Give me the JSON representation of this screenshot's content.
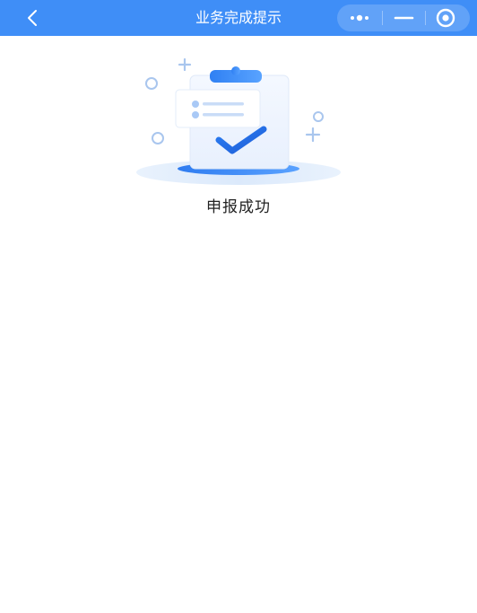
{
  "header": {
    "title": "业务完成提示",
    "background_color": "#3f8ef7",
    "back_icon": "chevron-left-icon",
    "menu_icon": "more-dots-icon",
    "minimize_icon": "minimize-icon",
    "close_icon": "target-circle-icon"
  },
  "result": {
    "message": "申报成功",
    "illustration_icon": "clipboard-check-icon",
    "accent_color": "#3f8ef7"
  }
}
